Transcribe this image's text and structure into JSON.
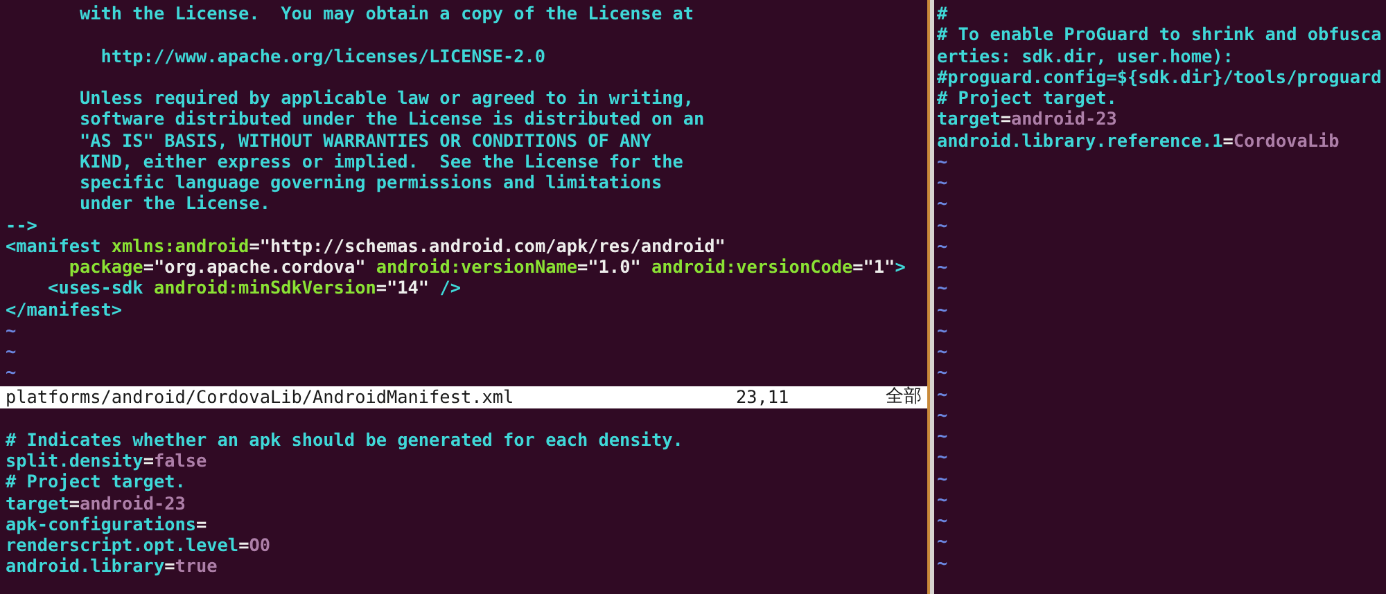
{
  "top_left_pane": {
    "lines": [
      {
        "kind": "code",
        "segments": [
          {
            "kind": "comment",
            "text": "       with the License.  You may obtain a copy of the License at"
          }
        ]
      },
      {
        "kind": "blank"
      },
      {
        "kind": "code",
        "segments": [
          {
            "kind": "comment",
            "text": "         http://www.apache.org/licenses/LICENSE-2.0"
          }
        ]
      },
      {
        "kind": "blank"
      },
      {
        "kind": "code",
        "segments": [
          {
            "kind": "comment",
            "text": "       Unless required by applicable law or agreed to in writing,"
          }
        ]
      },
      {
        "kind": "code",
        "segments": [
          {
            "kind": "comment",
            "text": "       software distributed under the License is distributed on an"
          }
        ]
      },
      {
        "kind": "code",
        "segments": [
          {
            "kind": "comment",
            "text": "       \"AS IS\" BASIS, WITHOUT WARRANTIES OR CONDITIONS OF ANY"
          }
        ]
      },
      {
        "kind": "code",
        "segments": [
          {
            "kind": "comment",
            "text": "       KIND, either express or implied.  See the License for the"
          }
        ]
      },
      {
        "kind": "code",
        "segments": [
          {
            "kind": "comment",
            "text": "       specific language governing permissions and limitations"
          }
        ]
      },
      {
        "kind": "code",
        "segments": [
          {
            "kind": "comment",
            "text": "       under the License."
          }
        ]
      },
      {
        "kind": "code",
        "segments": [
          {
            "kind": "comment",
            "text": "-->"
          }
        ]
      },
      {
        "kind": "code",
        "segments": [
          {
            "kind": "tag",
            "text": "<manifest "
          },
          {
            "kind": "attr",
            "text": "xmlns:android"
          },
          {
            "kind": "plain",
            "text": "="
          },
          {
            "kind": "string",
            "text": "\"http://schemas.android.com/apk/res/android\""
          }
        ]
      },
      {
        "kind": "code",
        "segments": [
          {
            "kind": "attr",
            "text": "      package"
          },
          {
            "kind": "plain",
            "text": "="
          },
          {
            "kind": "string",
            "text": "\"org.apache.cordova\" "
          },
          {
            "kind": "attr",
            "text": "android:versionName"
          },
          {
            "kind": "plain",
            "text": "="
          },
          {
            "kind": "string",
            "text": "\"1.0\" "
          },
          {
            "kind": "attr",
            "text": "android:versionCode"
          },
          {
            "kind": "plain",
            "text": "="
          },
          {
            "kind": "string",
            "text": "\"1\""
          },
          {
            "kind": "tag",
            "text": ">"
          }
        ]
      },
      {
        "kind": "code",
        "segments": [
          {
            "kind": "tag",
            "text": "    <uses-sdk "
          },
          {
            "kind": "attr",
            "text": "android:minSdkVersion"
          },
          {
            "kind": "plain",
            "text": "="
          },
          {
            "kind": "string",
            "text": "\"14\" "
          },
          {
            "kind": "tag",
            "text": "/>"
          }
        ]
      },
      {
        "kind": "code",
        "segments": [
          {
            "kind": "tag",
            "text": "</manifest>"
          }
        ]
      },
      {
        "kind": "tilde",
        "text": "~"
      },
      {
        "kind": "tilde",
        "text": "~"
      },
      {
        "kind": "tilde",
        "text": "~"
      }
    ],
    "status": {
      "file": "platforms/android/CordovaLib/AndroidManifest.xml",
      "cursor": "23,11",
      "scroll": "全部"
    }
  },
  "bottom_left_pane": {
    "lines": [
      {
        "kind": "blank"
      },
      {
        "kind": "code",
        "segments": [
          {
            "kind": "comment",
            "text": "# Indicates whether an apk should be generated for each density."
          }
        ]
      },
      {
        "kind": "code",
        "segments": [
          {
            "kind": "key",
            "text": "split.density"
          },
          {
            "kind": "plain",
            "text": "="
          },
          {
            "kind": "value",
            "text": "false"
          }
        ]
      },
      {
        "kind": "code",
        "segments": [
          {
            "kind": "comment",
            "text": "# Project target."
          }
        ]
      },
      {
        "kind": "code",
        "segments": [
          {
            "kind": "key",
            "text": "target"
          },
          {
            "kind": "plain",
            "text": "="
          },
          {
            "kind": "value",
            "text": "android-23"
          }
        ]
      },
      {
        "kind": "code",
        "segments": [
          {
            "kind": "key",
            "text": "apk-configurations"
          },
          {
            "kind": "plain",
            "text": "="
          }
        ]
      },
      {
        "kind": "code",
        "segments": [
          {
            "kind": "key",
            "text": "renderscript.opt.level"
          },
          {
            "kind": "plain",
            "text": "="
          },
          {
            "kind": "value",
            "text": "O0"
          }
        ]
      },
      {
        "kind": "code",
        "segments": [
          {
            "kind": "key",
            "text": "android.library"
          },
          {
            "kind": "plain",
            "text": "="
          },
          {
            "kind": "value",
            "text": "true"
          }
        ]
      }
    ]
  },
  "right_pane": {
    "lines": [
      {
        "kind": "code",
        "segments": [
          {
            "kind": "comment",
            "text": "#"
          }
        ]
      },
      {
        "kind": "code",
        "segments": [
          {
            "kind": "comment",
            "text": "# To enable ProGuard to shrink and obfusca"
          }
        ]
      },
      {
        "kind": "code",
        "segments": [
          {
            "kind": "comment",
            "text": "erties: sdk.dir, user.home):"
          }
        ]
      },
      {
        "kind": "code",
        "segments": [
          {
            "kind": "comment",
            "text": "#proguard.config=${sdk.dir}/tools/proguard"
          }
        ]
      },
      {
        "kind": "code",
        "segments": [
          {
            "kind": "comment",
            "text": "# Project target."
          }
        ]
      },
      {
        "kind": "code",
        "segments": [
          {
            "kind": "key",
            "text": "target"
          },
          {
            "kind": "plain",
            "text": "="
          },
          {
            "kind": "value",
            "text": "android-23"
          }
        ]
      },
      {
        "kind": "code",
        "segments": [
          {
            "kind": "key",
            "text": "android.library.reference.1"
          },
          {
            "kind": "plain",
            "text": "="
          },
          {
            "kind": "value",
            "text": "CordovaLib"
          }
        ]
      },
      {
        "kind": "tilde",
        "text": "~"
      },
      {
        "kind": "tilde",
        "text": "~"
      },
      {
        "kind": "tilde",
        "text": "~"
      },
      {
        "kind": "tilde",
        "text": "~"
      },
      {
        "kind": "tilde",
        "text": "~"
      },
      {
        "kind": "tilde",
        "text": "~"
      },
      {
        "kind": "tilde",
        "text": "~"
      },
      {
        "kind": "tilde",
        "text": "~"
      },
      {
        "kind": "tilde",
        "text": "~"
      },
      {
        "kind": "tilde",
        "text": "~"
      },
      {
        "kind": "tilde",
        "text": "~"
      },
      {
        "kind": "tilde",
        "text": "~"
      },
      {
        "kind": "tilde",
        "text": "~"
      },
      {
        "kind": "tilde",
        "text": "~"
      },
      {
        "kind": "tilde",
        "text": "~"
      },
      {
        "kind": "tilde",
        "text": "~"
      },
      {
        "kind": "tilde",
        "text": "~"
      },
      {
        "kind": "tilde",
        "text": "~"
      },
      {
        "kind": "tilde",
        "text": "~"
      },
      {
        "kind": "tilde",
        "text": "~"
      }
    ]
  }
}
